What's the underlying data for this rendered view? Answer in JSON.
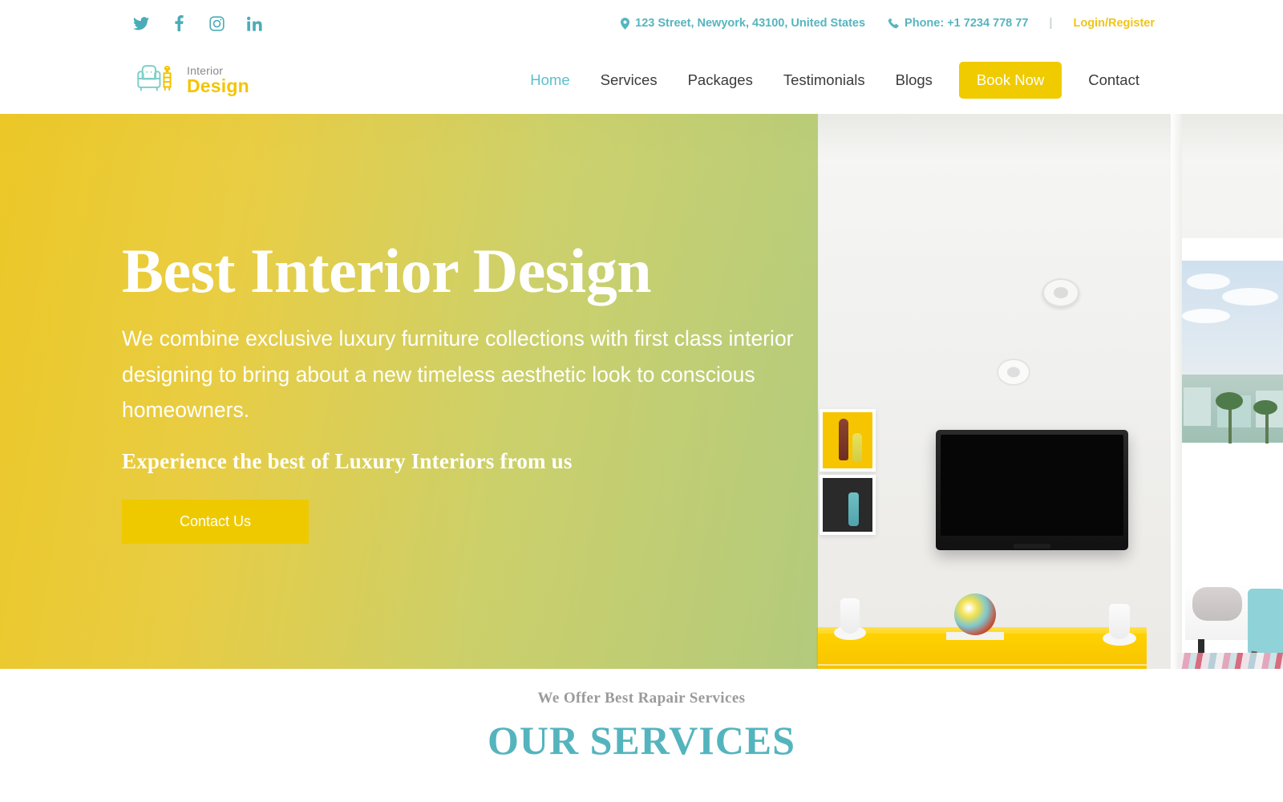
{
  "topbar": {
    "social": [
      {
        "name": "twitter-icon",
        "label": "Twitter"
      },
      {
        "name": "facebook-icon",
        "label": "Facebook"
      },
      {
        "name": "instagram-icon",
        "label": "Instagram"
      },
      {
        "name": "linkedin-icon",
        "label": "LinkedIn"
      }
    ],
    "address": "123 Street, Newyork, 43100, United States",
    "phone": "Phone: +1 7234 778 77",
    "divider": "|",
    "login": "Login/Register",
    "accent_color": "#55b5bf",
    "login_color": "#f0c419"
  },
  "header": {
    "logo": {
      "line1": "Interior",
      "line2": "Design"
    },
    "nav": [
      {
        "label": "Home",
        "active": true
      },
      {
        "label": "Services",
        "active": false
      },
      {
        "label": "Packages",
        "active": false
      },
      {
        "label": "Testimonials",
        "active": false
      },
      {
        "label": "Blogs",
        "active": false
      }
    ],
    "book_now": "Book Now",
    "contact": "Contact",
    "active_color": "#5cc0c9",
    "button_color": "#efcb00"
  },
  "hero": {
    "heading": "Best Interior Design",
    "paragraph": "We combine exclusive luxury furniture collections with first class interior designing to bring about a new timeless aesthetic look to conscious homeowners.",
    "tagline": "Experience the best of Luxury Interiors from us",
    "cta": "Contact Us",
    "overlay_from": "#ebc418",
    "overlay_to": "#a8c468",
    "cta_color": "#eec900"
  },
  "services": {
    "subtitle": "We Offer Best Rapair Services",
    "title": "OUR SERVICES",
    "title_color": "#54b4be",
    "subtitle_color": "#9a9a9a"
  }
}
